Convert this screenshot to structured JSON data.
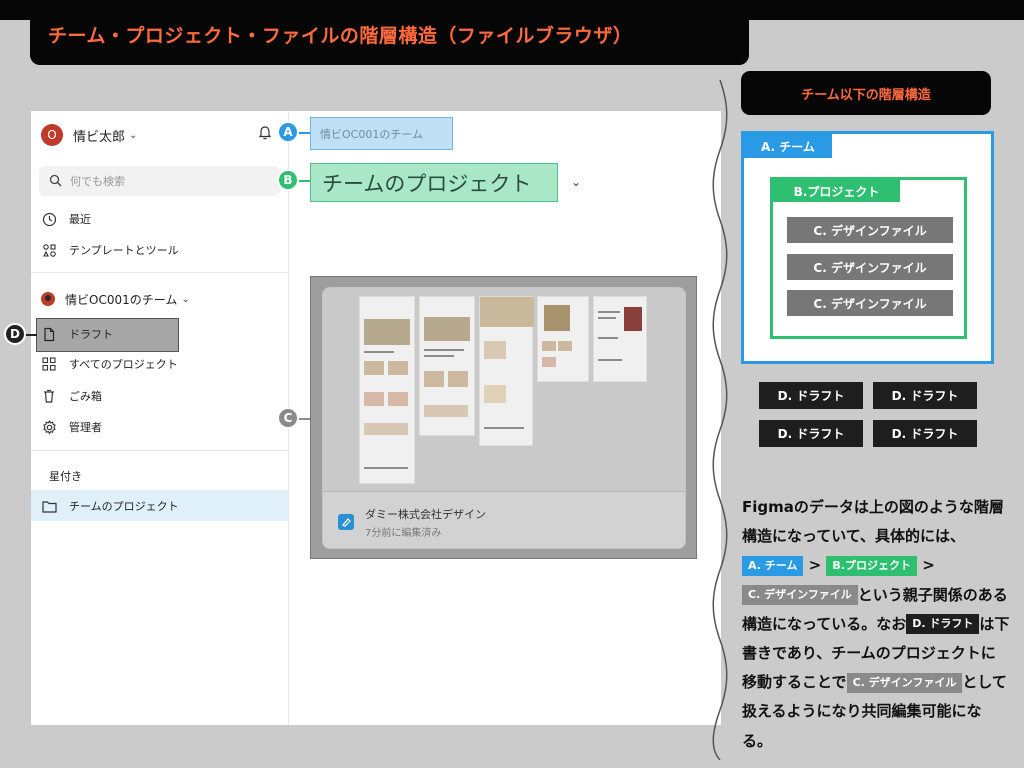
{
  "title": "チーム・プロジェクト・ファイルの階層構造（ファイルブラウザ）",
  "sidebar": {
    "avatar_initial": "O",
    "user_name": "情ビ太郎",
    "search_placeholder": "何でも検索",
    "nav": [
      {
        "label": "最近",
        "icon": "clock-icon"
      },
      {
        "label": "テンプレートとツール",
        "icon": "templates-icon"
      }
    ],
    "team_name": "情ビOC001のチーム",
    "team_nav": [
      {
        "label": "ドラフト",
        "icon": "file-icon"
      },
      {
        "label": "すべてのプロジェクト",
        "icon": "grid-icon"
      },
      {
        "label": "ごみ箱",
        "icon": "trash-icon"
      },
      {
        "label": "管理者",
        "icon": "gear-icon"
      }
    ],
    "starred_heading": "星付き",
    "starred_item": "チームのプロジェクト"
  },
  "main": {
    "team_label": "情ビOC001のチーム",
    "project_title": "チームのプロジェクト",
    "file": {
      "name": "ダミー株式会社デザイン",
      "edited": "7分前に編集済み"
    }
  },
  "markers": {
    "a": "A",
    "b": "B",
    "c": "C",
    "d": "D"
  },
  "right_panel": {
    "heading": "チーム以下の階層構造",
    "team_label": "A. チーム",
    "project_label": "B.プロジェクト",
    "file_labels": [
      "C. デザインファイル",
      "C. デザインファイル",
      "C. デザインファイル"
    ],
    "draft_labels": [
      "D. ドラフト",
      "D. ドラフト",
      "D. ドラフト",
      "D. ドラフト"
    ],
    "desc": {
      "p1": "Figmaのデータは上の図のような階層構造になっていて、具体的には、",
      "chip_a": "A. チーム",
      "sep1": " > ",
      "chip_b": "B.プロジェクト",
      "sep2": " > ",
      "chip_c": "C. デザインファイル",
      "p2": "という親子関係のある構造になっている。なお",
      "chip_d": "D. ドラフト",
      "p3": "は下書きであり、チームのプロジェクトに移動することで",
      "chip_c2": "C. デザインファイル",
      "p4": "として扱えるようになり共同編集可能になる。"
    }
  },
  "colors": {
    "title_orange": "#ff6a3d",
    "team_blue": "#2b9ae5",
    "project_green": "#2fbf71",
    "file_gray": "#777777",
    "draft_dark": "#1e1e1e"
  }
}
